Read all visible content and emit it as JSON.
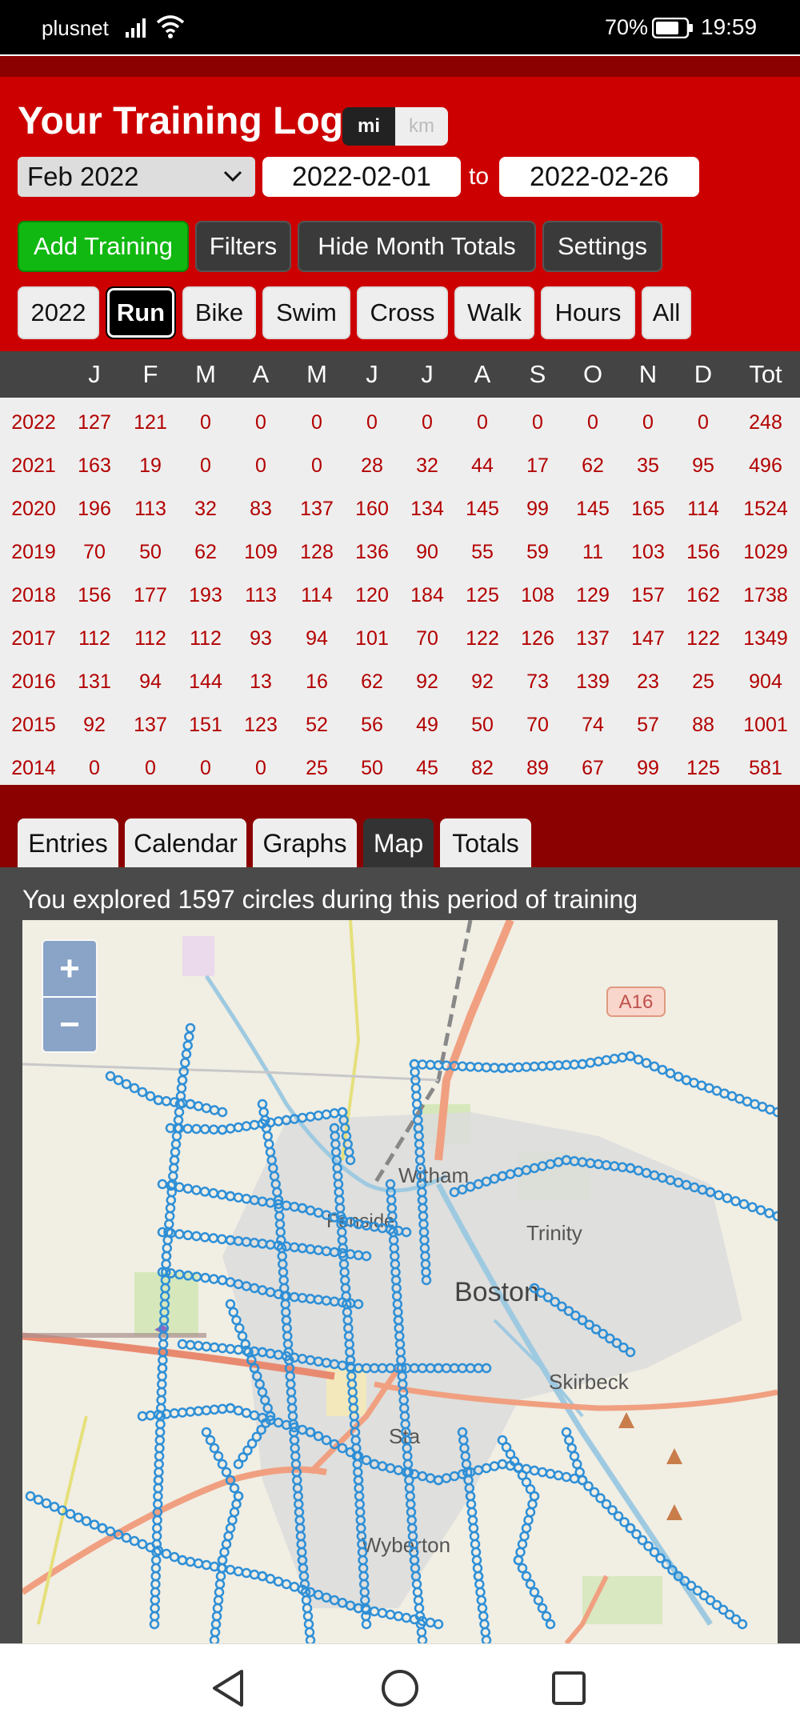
{
  "status": {
    "carrier": "plusnet",
    "battery": "70%",
    "time": "19:59"
  },
  "header": {
    "title": "Your Training Log",
    "unit_mi": "mi",
    "unit_km": "km",
    "month": "Feb 2022",
    "date_from": "2022-02-01",
    "date_to_label": "to",
    "date_to": "2022-02-26"
  },
  "actions": {
    "add_training": "Add Training",
    "filters": "Filters",
    "hide_totals": "Hide Month Totals",
    "settings": "Settings"
  },
  "sports": {
    "year": "2022",
    "run": "Run",
    "bike": "Bike",
    "swim": "Swim",
    "cross": "Cross",
    "walk": "Walk",
    "hours": "Hours",
    "all": "All"
  },
  "table": {
    "headers": [
      "J",
      "F",
      "M",
      "A",
      "M",
      "J",
      "J",
      "A",
      "S",
      "O",
      "N",
      "D",
      "Tot"
    ],
    "rows": [
      {
        "year": "2022",
        "values": [
          "127",
          "121",
          "0",
          "0",
          "0",
          "0",
          "0",
          "0",
          "0",
          "0",
          "0",
          "0",
          "248"
        ]
      },
      {
        "year": "2021",
        "values": [
          "163",
          "19",
          "0",
          "0",
          "0",
          "28",
          "32",
          "44",
          "17",
          "62",
          "35",
          "95",
          "496"
        ]
      },
      {
        "year": "2020",
        "values": [
          "196",
          "113",
          "32",
          "83",
          "137",
          "160",
          "134",
          "145",
          "99",
          "145",
          "165",
          "114",
          "1524"
        ]
      },
      {
        "year": "2019",
        "values": [
          "70",
          "50",
          "62",
          "109",
          "128",
          "136",
          "90",
          "55",
          "59",
          "11",
          "103",
          "156",
          "1029"
        ]
      },
      {
        "year": "2018",
        "values": [
          "156",
          "177",
          "193",
          "113",
          "114",
          "120",
          "184",
          "125",
          "108",
          "129",
          "157",
          "162",
          "1738"
        ]
      },
      {
        "year": "2017",
        "values": [
          "112",
          "112",
          "112",
          "93",
          "94",
          "101",
          "70",
          "122",
          "126",
          "137",
          "147",
          "122",
          "1349"
        ]
      },
      {
        "year": "2016",
        "values": [
          "131",
          "94",
          "144",
          "13",
          "16",
          "62",
          "92",
          "92",
          "73",
          "139",
          "23",
          "25",
          "904"
        ]
      },
      {
        "year": "2015",
        "values": [
          "92",
          "137",
          "151",
          "123",
          "52",
          "56",
          "49",
          "50",
          "70",
          "74",
          "57",
          "88",
          "1001"
        ]
      },
      {
        "year": "2014",
        "values": [
          "0",
          "0",
          "0",
          "0",
          "25",
          "50",
          "45",
          "82",
          "89",
          "67",
          "99",
          "125",
          "581"
        ]
      }
    ]
  },
  "tabs": {
    "entries": "Entries",
    "calendar": "Calendar",
    "graphs": "Graphs",
    "map": "Map",
    "totals": "Totals"
  },
  "map": {
    "caption": "You explored 1597 circles during this period of training",
    "zoom_in": "+",
    "zoom_out": "−",
    "labels": {
      "road": "A16",
      "witham": "Witham",
      "fenside": "Fenside",
      "trinity": "Trinity",
      "boston": "Boston",
      "skirbeck": "Skirbeck",
      "staniland": "Sta",
      "wyberton": "Wyberton"
    }
  }
}
